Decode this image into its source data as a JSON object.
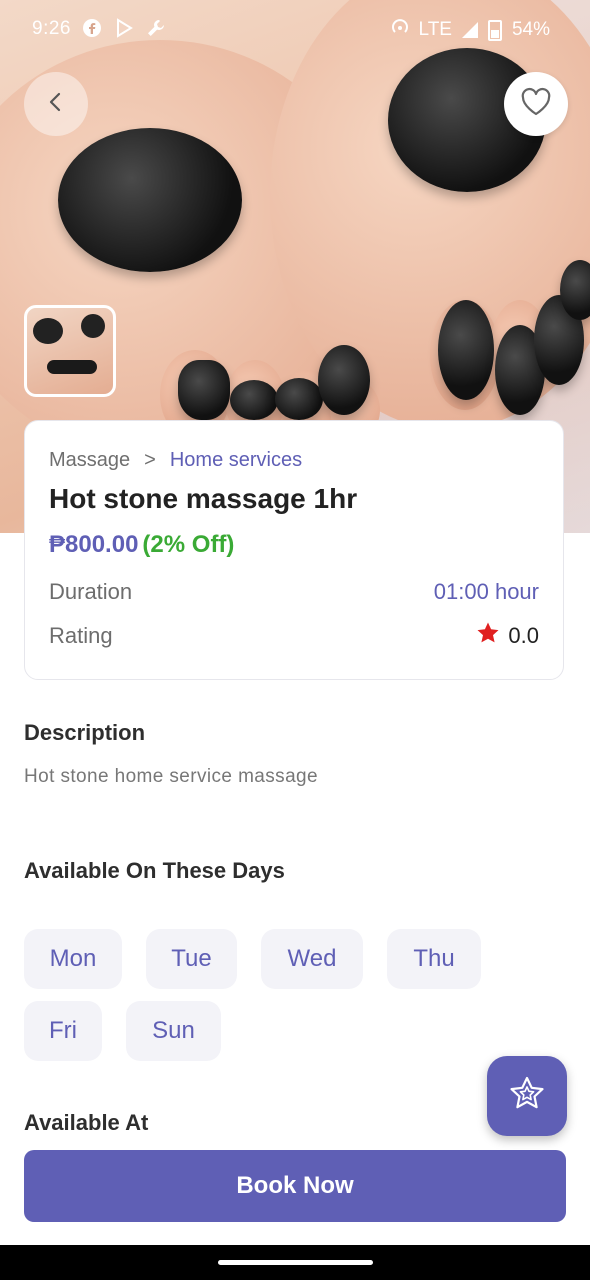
{
  "status_bar": {
    "time": "9:26",
    "network": "LTE",
    "battery": "54%",
    "icons": [
      "facebook-icon",
      "play-store-icon",
      "wrench-icon",
      "hotspot-icon",
      "signal-icon",
      "battery-icon"
    ]
  },
  "service": {
    "breadcrumb_parent": "Massage",
    "breadcrumb_separator": ">",
    "breadcrumb_category": "Home services",
    "title": "Hot stone massage 1hr",
    "price": "₱800.00",
    "discount": "(2% Off)",
    "duration_label": "Duration",
    "duration_value": "01:00 hour",
    "rating_label": "Rating",
    "rating_value": "0.0"
  },
  "description": {
    "heading": "Description",
    "text": "Hot stone home service massage"
  },
  "availability": {
    "heading": "Available On These Days",
    "days": [
      "Mon",
      "Tue",
      "Wed",
      "Thu",
      "Fri",
      "Sun"
    ],
    "at_heading": "Available At"
  },
  "actions": {
    "book_label": "Book Now"
  },
  "colors": {
    "accent": "#5f5fb5",
    "discount": "#3aaa35",
    "star": "#e02020",
    "chip_bg": "#f3f3f8"
  }
}
